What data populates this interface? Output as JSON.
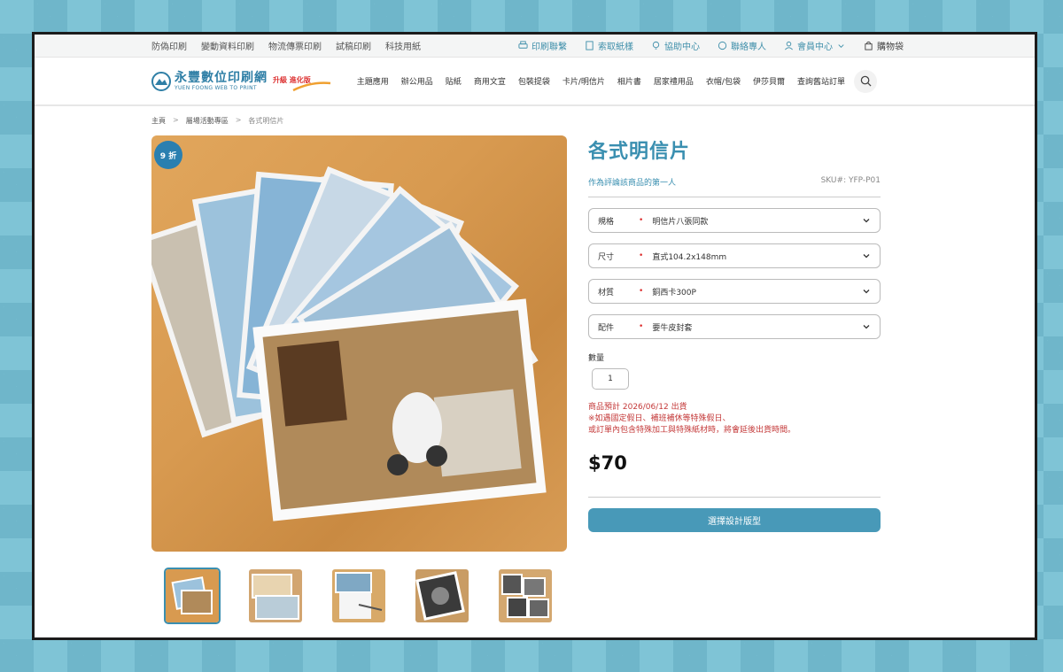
{
  "topbar": {
    "links": [
      "防偽印刷",
      "變動資料印刷",
      "物流傳票印刷",
      "試稿印刷",
      "科技用紙"
    ],
    "utils": {
      "print_contact": "印刷聯繫",
      "sample_request": "索取紙樣",
      "help_center": "協助中心",
      "contact_agent": "聯絡專人",
      "member_center": "會員中心",
      "cart": "購物袋"
    }
  },
  "header": {
    "logo_cn": "永豐數位印刷網",
    "logo_en": "YUEN FOONG WEB TO PRINT",
    "logo_badge": "升級 進化版",
    "nav": [
      "主題應用",
      "辦公用品",
      "貼紙",
      "商用文宣",
      "包裝提袋",
      "卡片/明信片",
      "相片書",
      "居家禮用品",
      "衣帽/包袋",
      "伊莎貝爾",
      "查詢舊站訂單"
    ]
  },
  "breadcrumb": {
    "home": "主頁",
    "category": "屬場活動專區",
    "current": "各式明信片"
  },
  "product": {
    "badge": "9 折",
    "title": "各式明信片",
    "review_link": "作為評論該商品的第一人",
    "sku": "SKU#: YFP-P01",
    "options": [
      {
        "label": "規格",
        "value": "明信片八張同款"
      },
      {
        "label": "尺寸",
        "value": "直式104.2x148mm"
      },
      {
        "label": "材質",
        "value": "銅西卡300P"
      },
      {
        "label": "配件",
        "value": "要牛皮封套"
      }
    ],
    "qty_label": "數量",
    "qty_value": "1",
    "notice_lines": [
      "商品預計 2026/06/12 出貨",
      "※如遇國定假日、補班補休等特殊假日、",
      "或訂單內包含特殊加工與特殊紙材時，將會延後出貨時間。"
    ],
    "price": "$70",
    "cta": "選擇設計版型"
  },
  "colors": {
    "accent": "#3a8fb0",
    "cta": "#4899b8",
    "notice": "#c43a3a",
    "badge": "#2a7fb0"
  }
}
